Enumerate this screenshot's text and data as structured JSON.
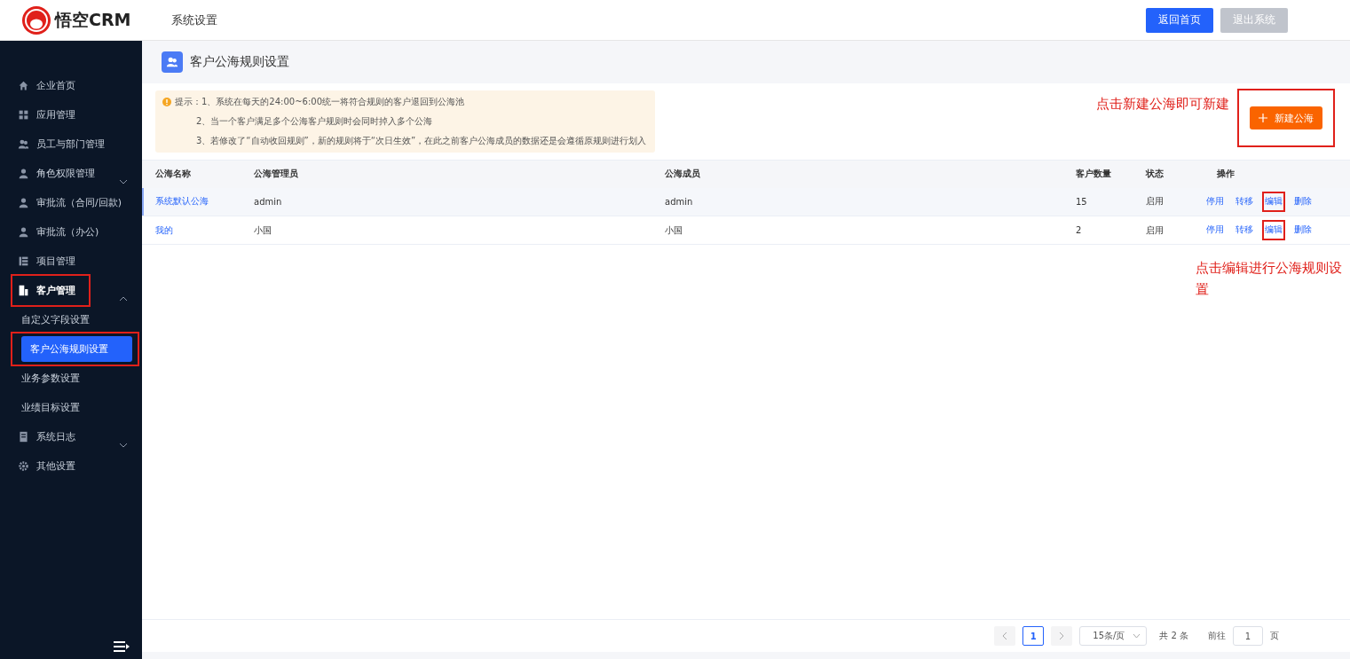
{
  "header": {
    "logo_text": "悟空CRM",
    "section_title": "系统设置",
    "buttons": [
      {
        "label": "返回首页",
        "disabled": false
      },
      {
        "label": "退出系统",
        "disabled": true
      }
    ]
  },
  "sidebar": {
    "items": [
      {
        "label": "企业首页",
        "highlighted": false
      },
      {
        "label": "应用管理",
        "highlighted": false
      },
      {
        "label": "员工与部门管理",
        "highlighted": false
      },
      {
        "label": "角色权限管理",
        "highlighted": false,
        "expanded": false
      },
      {
        "label": "审批流（合同/回款)",
        "highlighted": false
      },
      {
        "label": "审批流（办公)",
        "highlighted": false
      },
      {
        "label": "项目管理",
        "highlighted": false
      },
      {
        "label": "客户管理",
        "highlighted": true,
        "expanded": true,
        "children": [
          {
            "label": "自定义字段设置",
            "selected": false,
            "highlighted": false
          },
          {
            "label": "客户公海规则设置",
            "selected": true,
            "highlighted": true
          },
          {
            "label": "业务参数设置",
            "selected": false,
            "highlighted": false
          },
          {
            "label": "业绩目标设置",
            "selected": false,
            "highlighted": false
          }
        ]
      },
      {
        "label": "系统日志",
        "highlighted": false,
        "expanded": false
      },
      {
        "label": "其他设置",
        "highlighted": false
      }
    ]
  },
  "page": {
    "title": "客户公海规则设置",
    "tips": [
      "提示：1、系统在每天的24:00~6:00统一将符合规则的客户退回到公海池",
      "2、当一个客户满足多个公海客户规则时会同时掉入多个公海",
      "3、若修改了“自动收回规则”，新的规则将于“次日生效”，在此之前客户公海成员的数据还是会遵循原规则进行划入"
    ],
    "new_button": {
      "label": "新建公海",
      "highlighted": true
    },
    "annotations": [
      "点击新建公海即可新建",
      "点击编辑进行公海规则设置"
    ],
    "table": {
      "columns": [
        "公海名称",
        "公海管理员",
        "公海成员",
        "客户数量",
        "状态",
        "操作"
      ],
      "rows": [
        {
          "name": "系统默认公海",
          "admin": "admin",
          "members": "admin",
          "count": "15",
          "status": "启用",
          "selected": true,
          "actions": [
            {
              "label": "停用",
              "highlighted": false
            },
            {
              "label": "转移",
              "highlighted": false
            },
            {
              "label": "编辑",
              "highlighted": true
            },
            {
              "label": "删除",
              "highlighted": false
            }
          ]
        },
        {
          "name": "我的",
          "admin": "小国",
          "members": "小国",
          "count": "2",
          "status": "启用",
          "selected": false,
          "actions": [
            {
              "label": "停用",
              "highlighted": false
            },
            {
              "label": "转移",
              "highlighted": false
            },
            {
              "label": "编辑",
              "highlighted": true
            },
            {
              "label": "删除",
              "highlighted": false
            }
          ]
        }
      ]
    },
    "pagination": {
      "current_page": "1",
      "page_size": "15条/页",
      "total": "共 2 条",
      "goto_label": "前往",
      "goto_value": "1",
      "page_unit": "页"
    }
  }
}
